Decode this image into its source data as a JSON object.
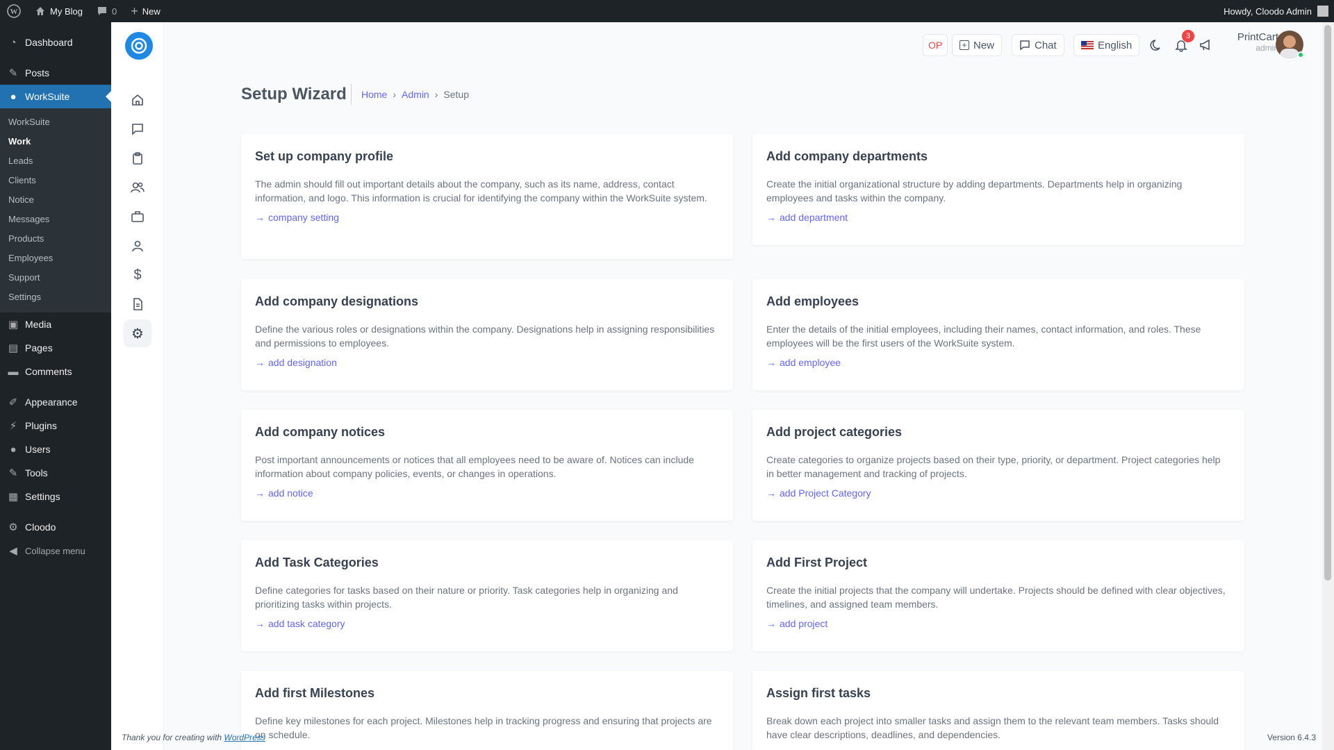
{
  "adminbar": {
    "site_name": "My Blog",
    "comments_count": "0",
    "new_label": "New",
    "howdy": "Howdy, Cloodo Admin"
  },
  "wpmenu": {
    "dashboard": "Dashboard",
    "posts": "Posts",
    "worksuite": "WorkSuite",
    "submenu": [
      "WorkSuite",
      "Work",
      "Leads",
      "Clients",
      "Notice",
      "Messages",
      "Products",
      "Employees",
      "Support",
      "Settings"
    ],
    "media": "Media",
    "pages": "Pages",
    "comments": "Comments",
    "appearance": "Appearance",
    "plugins": "Plugins",
    "users": "Users",
    "tools": "Tools",
    "settings": "Settings",
    "cloodo": "Cloodo",
    "collapse": "Collapse menu"
  },
  "header": {
    "op_label": "OP",
    "new_label": "New",
    "chat_label": "Chat",
    "language": "English",
    "notifications_count": "3",
    "user_name": "PrintCart",
    "user_role": "admin"
  },
  "page": {
    "title": "Setup Wizard",
    "breadcrumb": {
      "home": "Home",
      "admin": "Admin",
      "current": "Setup"
    }
  },
  "cards": [
    {
      "title": "Set up company profile",
      "desc": "The admin should fill out important details about the company, such as its name, address, contact information, and logo. This information is crucial for identifying the company within the WorkSuite system.",
      "action": "company setting"
    },
    {
      "title": "Add company departments",
      "desc": "Create the initial organizational structure by adding departments. Departments help in organizing employees and tasks within the company.",
      "action": "add department"
    },
    {
      "title": "Add company designations",
      "desc": "Define the various roles or designations within the company. Designations help in assigning responsibilities and permissions to employees.",
      "action": "add designation"
    },
    {
      "title": "Add employees",
      "desc": "Enter the details of the initial employees, including their names, contact information, and roles. These employees will be the first users of the WorkSuite system.",
      "action": "add employee"
    },
    {
      "title": "Add company notices",
      "desc": "Post important announcements or notices that all employees need to be aware of. Notices can include information about company policies, events, or changes in operations.",
      "action": "add notice"
    },
    {
      "title": "Add project categories",
      "desc": "Create categories to organize projects based on their type, priority, or department. Project categories help in better management and tracking of projects.",
      "action": "add Project Category"
    },
    {
      "title": "Add Task Categories",
      "desc": "Define categories for tasks based on their nature or priority. Task categories help in organizing and prioritizing tasks within projects.",
      "action": "add task category"
    },
    {
      "title": "Add First Project",
      "desc": "Create the initial projects that the company will undertake. Projects should be defined with clear objectives, timelines, and assigned team members.",
      "action": "add project"
    },
    {
      "title": "Add first Milestones",
      "desc": "Define key milestones for each project. Milestones help in tracking progress and ensuring that projects are on schedule.",
      "action": ""
    },
    {
      "title": "Assign first tasks",
      "desc": "Break down each project into smaller tasks and assign them to the relevant team members. Tasks should have clear descriptions, deadlines, and dependencies.",
      "action": ""
    }
  ],
  "footer": {
    "thanks": "Thank you for creating with",
    "wordpress": "WordPress",
    "version": "Version 6.4.3"
  },
  "colors": {
    "wp_dark": "#1d2327",
    "wp_blue": "#2271b1",
    "accent": "#6366f1",
    "logo_blue": "#1e88e5"
  }
}
